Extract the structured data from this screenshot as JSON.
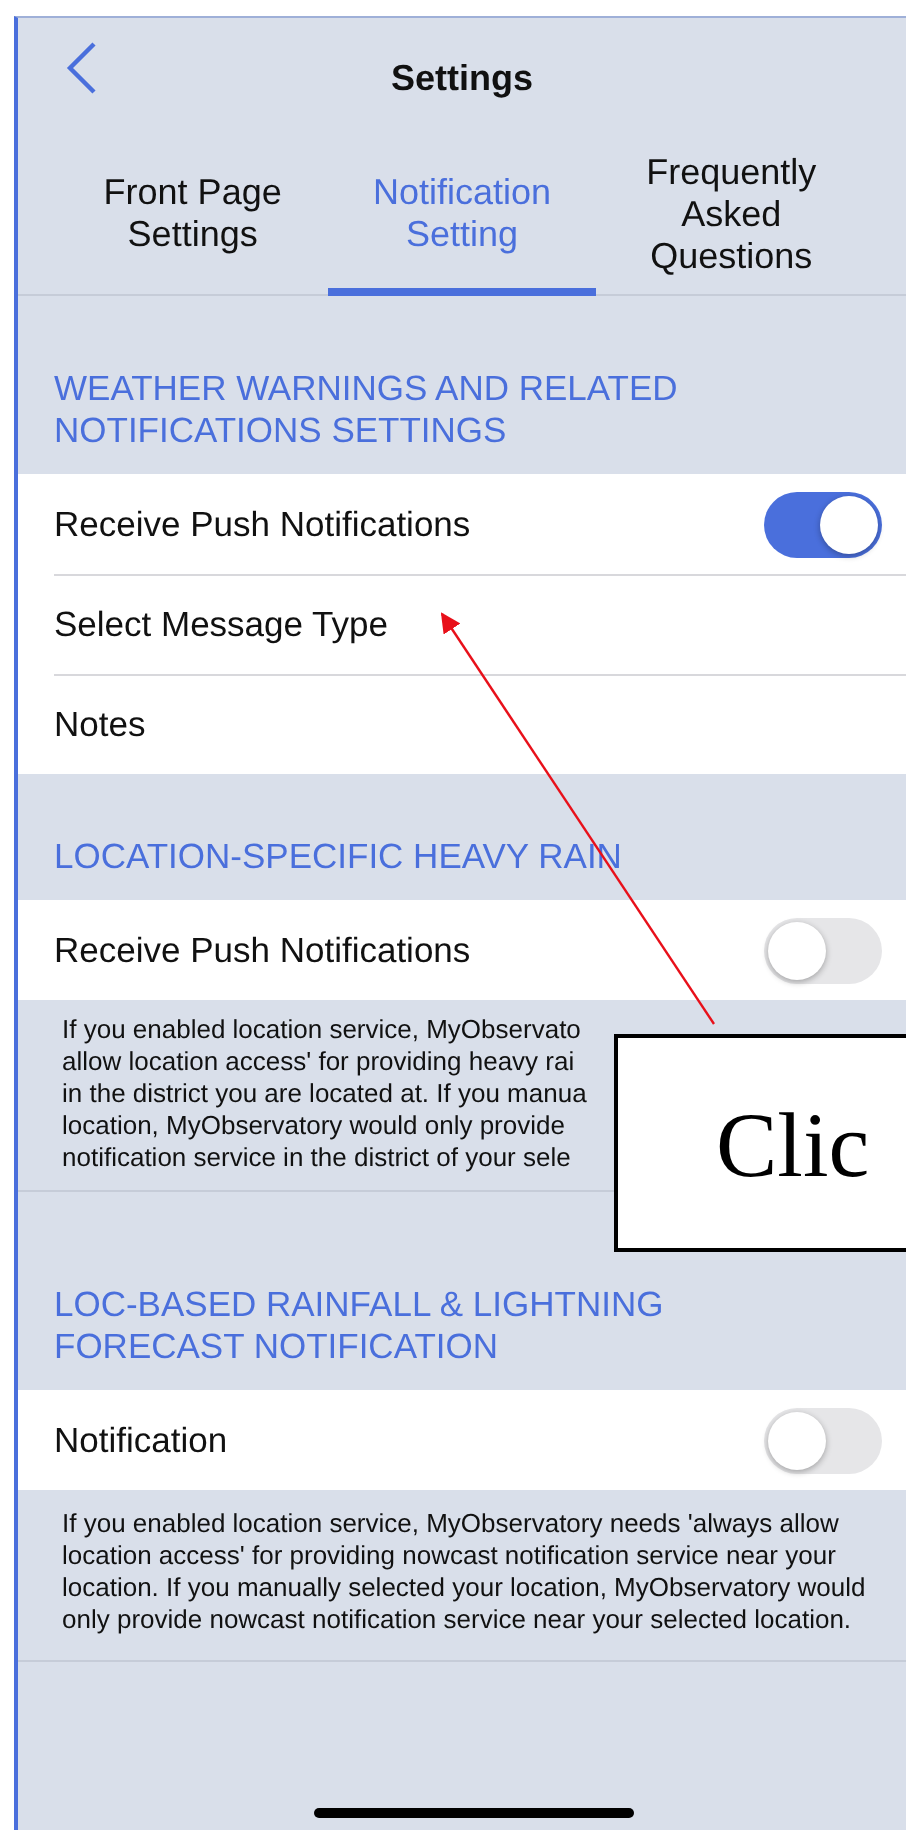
{
  "nav": {
    "title": "Settings"
  },
  "tabs": [
    {
      "label": "Front Page Settings",
      "selected": false
    },
    {
      "label": "Notification Setting",
      "selected": true
    },
    {
      "label": "Frequently Asked Questions",
      "selected": false
    }
  ],
  "sections": [
    {
      "header": "WEATHER WARNINGS AND RELATED NOTIFICATIONS SETTINGS",
      "rows": [
        {
          "kind": "toggle",
          "label": "Receive Push Notifications",
          "on": true
        },
        {
          "kind": "link",
          "label": "Select Message Type"
        },
        {
          "kind": "link",
          "label": "Notes"
        }
      ]
    },
    {
      "header": "LOCATION-SPECIFIC HEAVY RAIN",
      "rows": [
        {
          "kind": "toggle",
          "label": "Receive Push Notifications",
          "on": false
        }
      ],
      "note_lines": [
        "If you enabled location service, MyObservato",
        "allow location access' for providing heavy rai",
        "in the district you are located at. If you manua",
        "location, MyObservatory would only provide",
        "notification service in the district of your sele"
      ]
    },
    {
      "header": "LOC-BASED RAINFALL & LIGHTNING FORECAST NOTIFICATION",
      "rows": [
        {
          "kind": "toggle",
          "label": "Notification",
          "on": false
        }
      ],
      "note": "If you enabled location service, MyObservatory needs 'always allow location access' for providing nowcast notification service near your location. If you manually selected your location, MyObservatory would only provide nowcast notification service near your selected location."
    }
  ],
  "callout": {
    "text": "Clic"
  }
}
